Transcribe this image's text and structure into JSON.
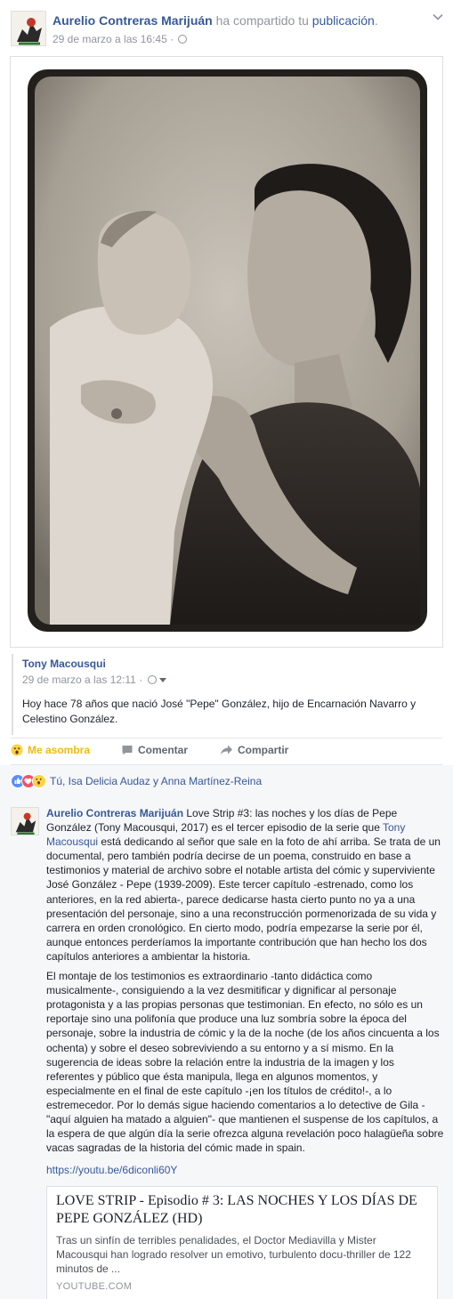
{
  "post_header": {
    "author": "Aurelio Contreras Marijuán",
    "action_text": " ha compartido tu ",
    "object_link": "publicación",
    "end": ".",
    "timestamp": "29 de marzo a las 16:45 ·"
  },
  "original_post": {
    "author": "Tony Macousqui",
    "timestamp": "29 de marzo a las 12:11 ·",
    "text": "Hoy hace 78 años que nació José \"Pepe\" González, hijo de Encarnación Navarro y Celestino González."
  },
  "actions": {
    "reaction_label": "Me asombra",
    "comment_label": "Comentar",
    "share_label": "Compartir"
  },
  "reactions": {
    "names": "Tú, Isa Delicia Audaz y Anna Martínez-Reina",
    "types": [
      "like",
      "love",
      "wow"
    ]
  },
  "comment": {
    "author": "Aurelio Contreras Marijuán",
    "p1_part1": " Love Strip #3: las noches y los días de Pepe González (Tony Macousqui, 2017) es el tercer episodio de la serie que ",
    "p1_mention": "Tony Macousqui",
    "p1_part2": " está dedicando al señor que sale en la foto de ahí arriba. Se trata de un documental, pero también podría decirse de un poema, construido en base a testimonios y material de archivo sobre el notable artista del cómic y superviviente José González - Pepe (1939-2009). Este tercer capítulo -estrenado, como los anteriores, en la red abierta-, parece dedicarse hasta cierto punto no ya a una presentación del personaje, sino a una reconstrucción pormenorizada de su vida y carrera en orden cronológico. En cierto modo, podría empezarse la serie por él, aunque entonces perderíamos la importante contribución que han hecho los dos capítulos anteriores a ambientar la historia.",
    "p2": "El montaje de los testimonios es extraordinario -tanto didáctica como musicalmente-, consiguiendo a la vez desmitificar y dignificar al personaje protagonista y a las propias personas que testimonian. En efecto, no sólo es un reportaje sino una polifonía que produce una luz sombría sobre la época del personaje, sobre la industria de cómic y la de la noche (de los años cincuenta a los ochenta) y sobre el deseo sobreviviendo a su entorno y a sí mismo. En la sugerencia de ideas sobre la relación entre la industria de la imagen y los referentes y público que ésta manipula, llega en algunos momentos, y especialmente en el final de este capítulo -¡en los títulos de crédito!-, a lo estremecedor. Por lo demás sigue haciendo comentarios a lo detective de Gila -\"aquí alguien ha matado a alguien\"- que mantienen el suspense de los capítulos, a la espera de que algún día la serie ofrezca alguna revelación poco halagüeña sobre vacas sagradas de la historia del cómic made in spain.",
    "url": "https://youtu.be/6diconli60Y"
  },
  "link_card": {
    "title": "LOVE STRIP - Episodio # 3: LAS NOCHES Y LOS DÍAS DE PEPE GONZÁLEZ (HD)",
    "description": "Tras un sinfín de terribles penalidades, el Doctor Mediavilla y Mister Macousqui han logrado resolver un emotivo, turbulento docu-thriller de 122 minutos de ...",
    "domain": "YOUTUBE.COM"
  },
  "colors": {
    "link_blue": "#365899",
    "meta_gray": "#90949c",
    "wow_yellow": "#f0ba15",
    "comment_bg": "#f6f7f9"
  }
}
